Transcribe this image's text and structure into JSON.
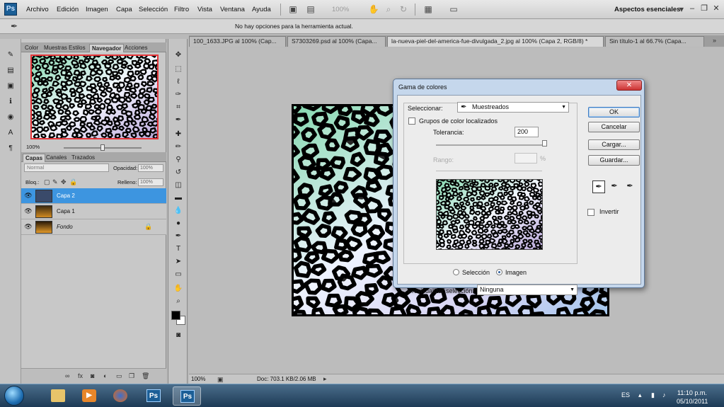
{
  "app": {
    "logo": "Ps",
    "workspace": "Aspectos esenciales"
  },
  "menu": [
    "Archivo",
    "Edición",
    "Imagen",
    "Capa",
    "Selección",
    "Filtro",
    "Vista",
    "Ventana",
    "Ayuda"
  ],
  "menubar_zoom": "100%",
  "options_bar": {
    "hint": "No hay opciones para la herramienta actual."
  },
  "panels": {
    "top_tabs": [
      "Color",
      "Muestras",
      "Estilos",
      "Navegador",
      "Acciones"
    ],
    "navigator_zoom": "100%",
    "layer_tabs": [
      "Capas",
      "Canales",
      "Trazados"
    ],
    "blend_mode": "Normal",
    "opacity_label": "Opacidad:",
    "opacity_value": "100%",
    "lock_label": "Bloq.:",
    "fill_label": "Relleno:",
    "fill_value": "100%",
    "layers": [
      {
        "name": "Capa 2",
        "selected": true
      },
      {
        "name": "Capa 1",
        "selected": false
      },
      {
        "name": "Fondo",
        "selected": false,
        "locked": true
      }
    ]
  },
  "doc_tabs": [
    "100_1633.JPG al 100% (Cap...",
    "S7303269.psd al 100% (Capa...",
    "la-nueva-piel-del-america-fue-divulgada_2.jpg al 100% (Capa 2, RGB/8) *",
    "Sin título-1 al 66.7% (Capa..."
  ],
  "status": {
    "zoom": "100%",
    "doc": "Doc: 703.1 KB/2.06 MB"
  },
  "dialog": {
    "title": "Gama de colores",
    "select_label": "Seleccionar:",
    "select_value": "Muestreados",
    "localized_label": "Grupos de color localizados",
    "tolerance_label": "Tolerancia:",
    "tolerance_value": "200",
    "range_label": "Rango:",
    "range_unit": "%",
    "radio_selection": "Selección",
    "radio_image": "Imagen",
    "preview_label": "Previsualizar selección:",
    "preview_value": "Ninguna",
    "buttons": {
      "ok": "OK",
      "cancel": "Cancelar",
      "load": "Cargar...",
      "save": "Guardar..."
    },
    "invert_label": "Invertir"
  },
  "taskbar": {
    "lang": "ES",
    "time": "11:10 p.m.",
    "date": "05/10/2011"
  }
}
